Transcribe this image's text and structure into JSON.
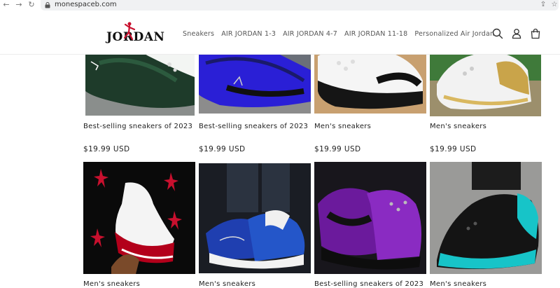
{
  "browser": {
    "url": "monespaceb.com",
    "icons": [
      "back-icon",
      "forward-icon",
      "reload-icon",
      "lock-icon",
      "share-icon",
      "bookmark-star-icon"
    ]
  },
  "header": {
    "logo_text": "JORDAN",
    "menu": [
      "Sneakers",
      "AIR JORDAN 1-3",
      "AIR JORDAN 4-7",
      "AIR JORDAN 11-18",
      "Personalized Air Jordan"
    ],
    "icons": [
      "search-icon",
      "account-icon",
      "cart-icon"
    ]
  },
  "products_row1": [
    {
      "title": "Best-selling sneakers of 2023",
      "price": "$19.99 USD",
      "image": "dark-green-sneaker"
    },
    {
      "title": "Best-selling sneakers of 2023",
      "price": "$19.99 USD",
      "image": "royal-blue-sneaker"
    },
    {
      "title": "Men's sneakers",
      "price": "$19.99 USD",
      "image": "white-black-retro-13"
    },
    {
      "title": "Men's sneakers",
      "price": "$19.99 USD",
      "image": "white-gold-retro-13"
    }
  ],
  "products_row2": [
    {
      "title": "Men's sneakers",
      "image": "white-red-patent-retro-11"
    },
    {
      "title": "Men's sneakers",
      "image": "blue-white-retro-13"
    },
    {
      "title": "Best-selling sneakers of 2023",
      "image": "purple-black-retro-13"
    },
    {
      "title": "Men's sneakers",
      "image": "black-teal-retro-13"
    }
  ],
  "colors": {
    "accent_red": "#c8102e",
    "text": "#222222",
    "menu_text": "#555555"
  }
}
